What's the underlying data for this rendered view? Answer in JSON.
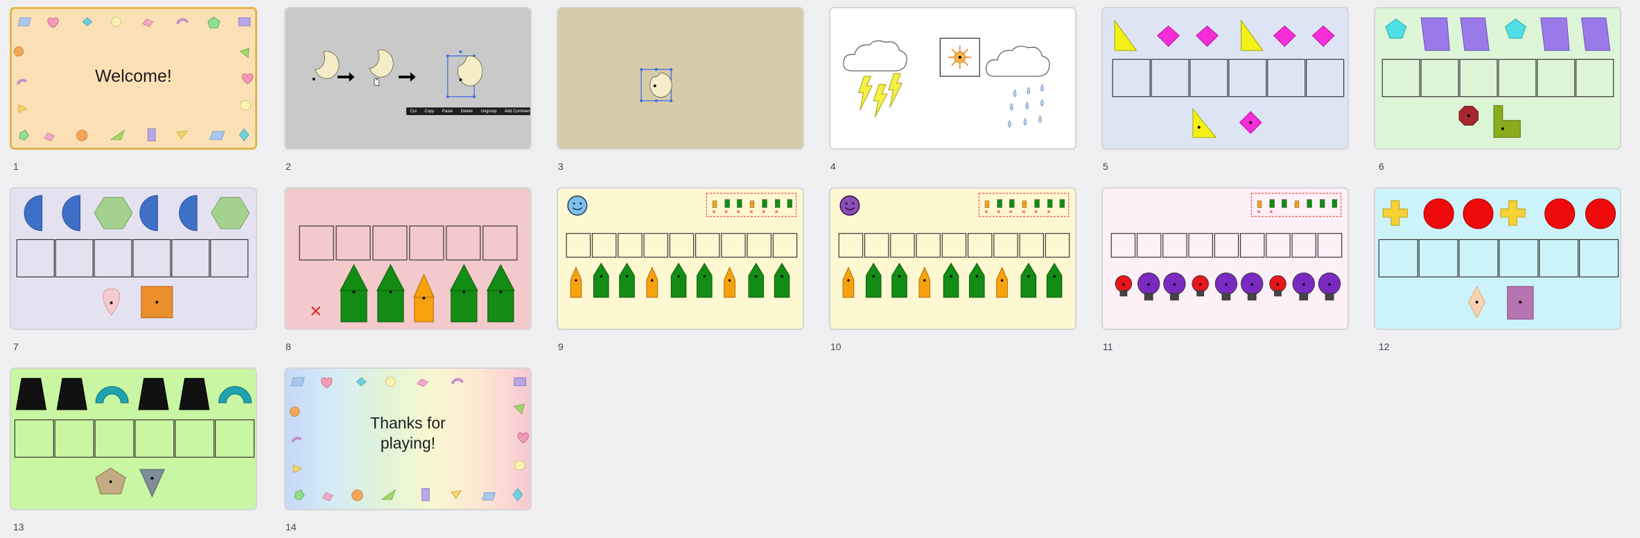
{
  "slides": [
    {
      "number": "1",
      "title": "Welcome!"
    },
    {
      "number": "2",
      "context_menu": [
        "Cut",
        "Copy",
        "Paste",
        "Delete",
        "Ungroup",
        "Add Comment"
      ]
    },
    {
      "number": "3"
    },
    {
      "number": "4"
    },
    {
      "number": "5"
    },
    {
      "number": "6"
    },
    {
      "number": "7"
    },
    {
      "number": "8"
    },
    {
      "number": "9"
    },
    {
      "number": "10"
    },
    {
      "number": "11"
    },
    {
      "number": "12"
    },
    {
      "number": "13"
    },
    {
      "number": "14",
      "title_line1": "Thanks for",
      "title_line2": "playing!"
    }
  ],
  "selected_slide": "1",
  "colors": {
    "bg": "#efeff2",
    "selected_border": "#e3b64c",
    "slide1_bg": "#fbe0b6",
    "slide2_bg": "#c9c9c9",
    "slide3_bg": "#d6cba9",
    "slide5_bg": "#dde5f5",
    "slide6_bg": "#dcf5d7",
    "slide7_bg": "#e4e2f1",
    "slide8_bg": "#f4c9cb",
    "slide9_bg": "#fdf7d2",
    "slide11_bg": "#fdf0f7",
    "slide12_bg": "#cdf3fa",
    "slide13_bg": "#c9f6a2"
  }
}
